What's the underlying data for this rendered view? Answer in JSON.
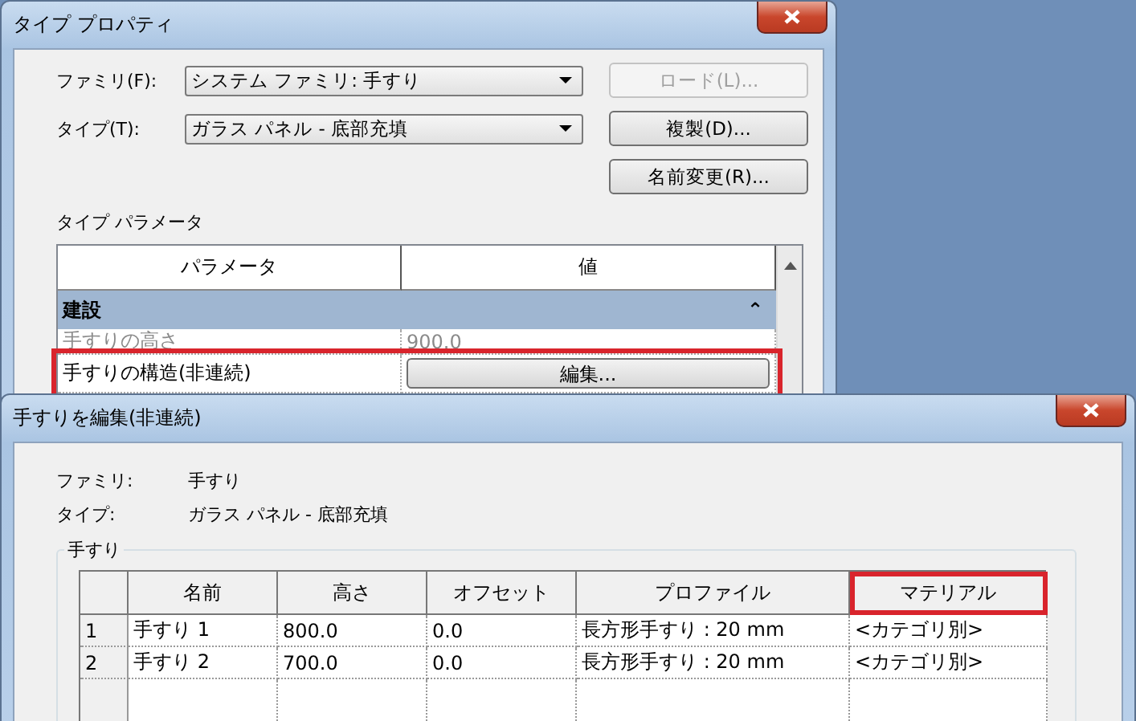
{
  "type_properties": {
    "title": "タイプ プロパティ",
    "fields": [
      {
        "label": "ファミリ(F):",
        "value": "システム ファミリ: 手すり"
      },
      {
        "label": "タイプ(T):",
        "value": "ガラス パネル - 底部充填"
      }
    ],
    "buttons": [
      {
        "label": "ロード(L)...",
        "disabled": true
      },
      {
        "label": "複製(D)...",
        "disabled": false
      },
      {
        "label": "名前変更(R)...",
        "disabled": false
      }
    ],
    "section_label": "タイプ パラメータ",
    "table": {
      "columns": [
        "パラメータ",
        "値"
      ],
      "group": {
        "label": "建設",
        "toggle": "⌃"
      },
      "rows": [
        {
          "kind": "text",
          "name": "手すりの高さ",
          "value": "900.0",
          "disabled": true,
          "highlighted": false
        },
        {
          "kind": "button",
          "name": "手すりの構造(非連続)",
          "value": "編集...",
          "disabled": false,
          "highlighted": true
        }
      ]
    }
  },
  "edit_dialog": {
    "title": "手すりを編集(非連続)",
    "info": [
      {
        "label": "ファミリ:",
        "value": "手すり"
      },
      {
        "label": "タイプ:",
        "value": "ガラス パネル - 底部充填"
      }
    ],
    "group_label": "手すり",
    "table": {
      "columns": [
        {
          "label": "名前",
          "highlighted": false
        },
        {
          "label": "高さ",
          "highlighted": false
        },
        {
          "label": "オフセット",
          "highlighted": false
        },
        {
          "label": "プロファイル",
          "highlighted": false
        },
        {
          "label": "マテリアル",
          "highlighted": true
        }
      ],
      "rows": [
        {
          "index": "1",
          "cells": [
            "手すり 1",
            "800.0",
            "0.0",
            "長方形手すり : 20 mm",
            "<カテゴリ別>"
          ]
        },
        {
          "index": "2",
          "cells": [
            "手すり 2",
            "700.0",
            "0.0",
            "長方形手すり : 20 mm",
            "<カテゴリ別>"
          ]
        }
      ]
    }
  }
}
